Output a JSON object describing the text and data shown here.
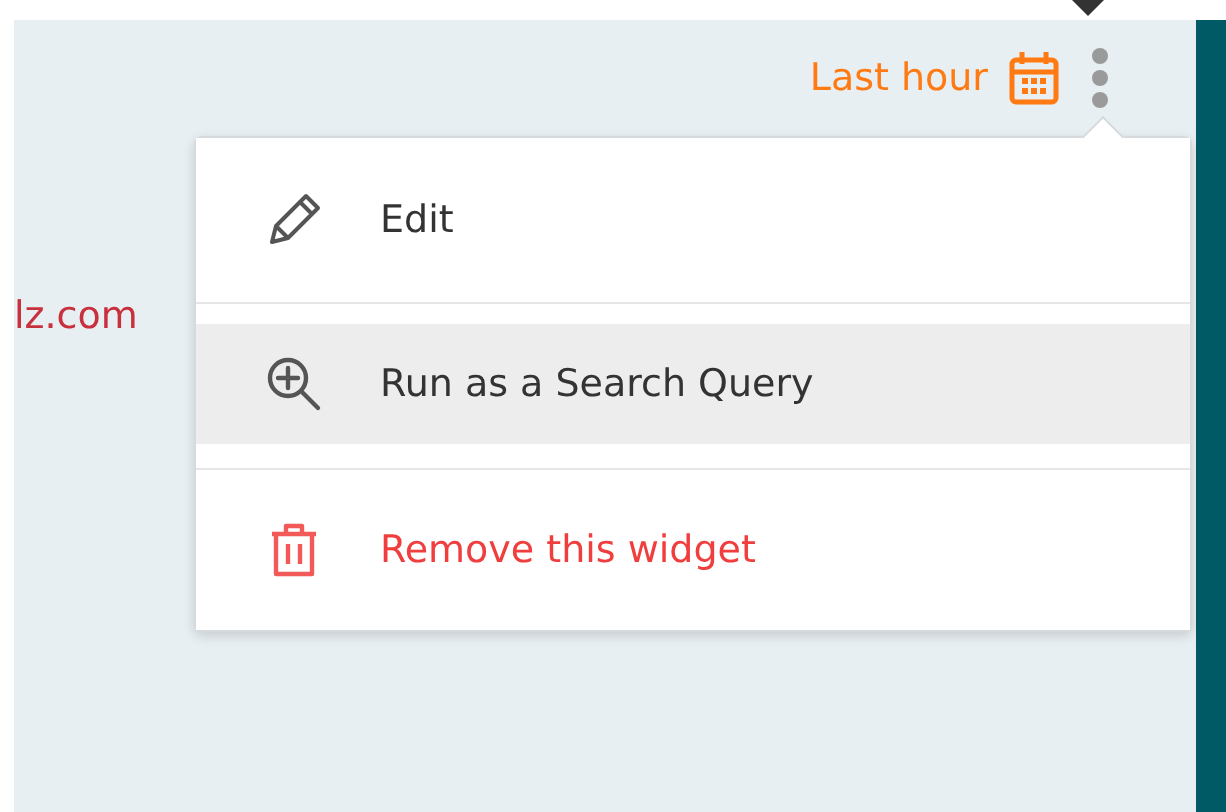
{
  "site_label": "lz.com",
  "time_range": {
    "label": "Last hour"
  },
  "menu": {
    "items": [
      {
        "kind": "edit",
        "label": "Edit",
        "highlighted": false
      },
      {
        "kind": "search",
        "label": "Run as a Search Query",
        "highlighted": true
      },
      {
        "kind": "remove",
        "label": "Remove this widget",
        "highlighted": false
      }
    ]
  }
}
